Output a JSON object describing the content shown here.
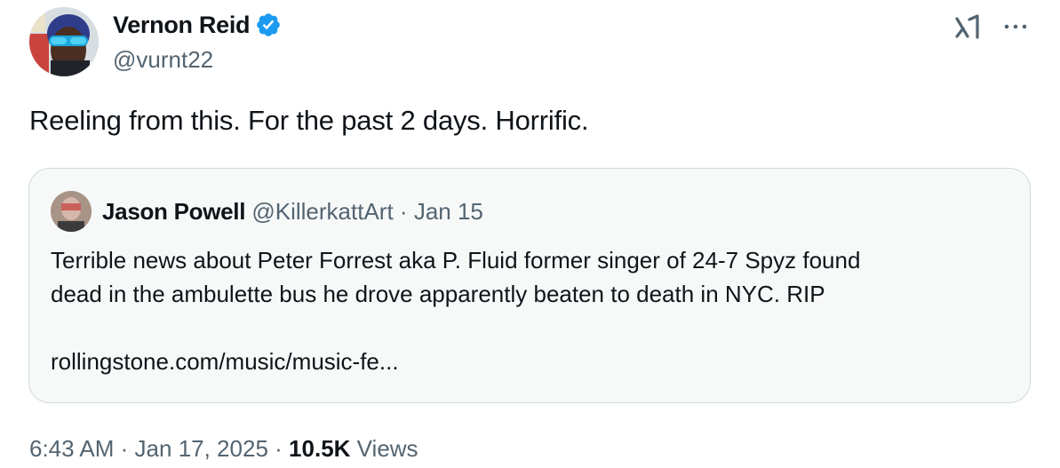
{
  "author": {
    "name": "Vernon Reid",
    "handle": "@vurnt22",
    "verified_color": "#1d9bf0"
  },
  "tweet": {
    "text": "Reeling from this. For the past 2 days. Horrific."
  },
  "quoted_tweet": {
    "name": "Jason Powell",
    "handle": "@KillerkattArt",
    "separator": "·",
    "date": "Jan 15",
    "text_line1": "Terrible news about Peter Forrest aka P. Fluid former singer of 24-7 Spyz found",
    "text_line2": "dead in the ambulette bus he drove apparently beaten to death in NYC. RIP",
    "link": "rollingstone.com/music/music-fe..."
  },
  "footer": {
    "time": "6:43 AM",
    "separator": "·",
    "date": "Jan 17, 2025",
    "separator2": "·",
    "views_count": "10.5K",
    "views_label": "Views"
  },
  "icons": {
    "grok": "grok-icon",
    "more": "more-icon",
    "verified": "verified-badge-icon"
  }
}
